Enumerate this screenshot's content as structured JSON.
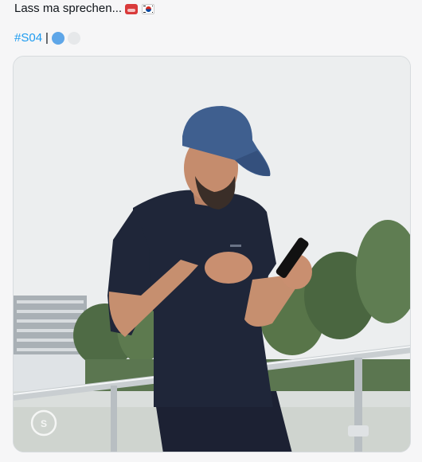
{
  "post": {
    "text": "Lass ma sprechen...",
    "emoji_1": "telephone-emoji",
    "emoji_2": "south-korea-flag-emoji",
    "hashtag": "#S04",
    "separator": "|",
    "dot_colors": [
      "#5ea6e8",
      "#e6e8ea"
    ]
  },
  "media": {
    "type": "video-still",
    "watermark_icon": "schalke-04-crest-icon"
  }
}
